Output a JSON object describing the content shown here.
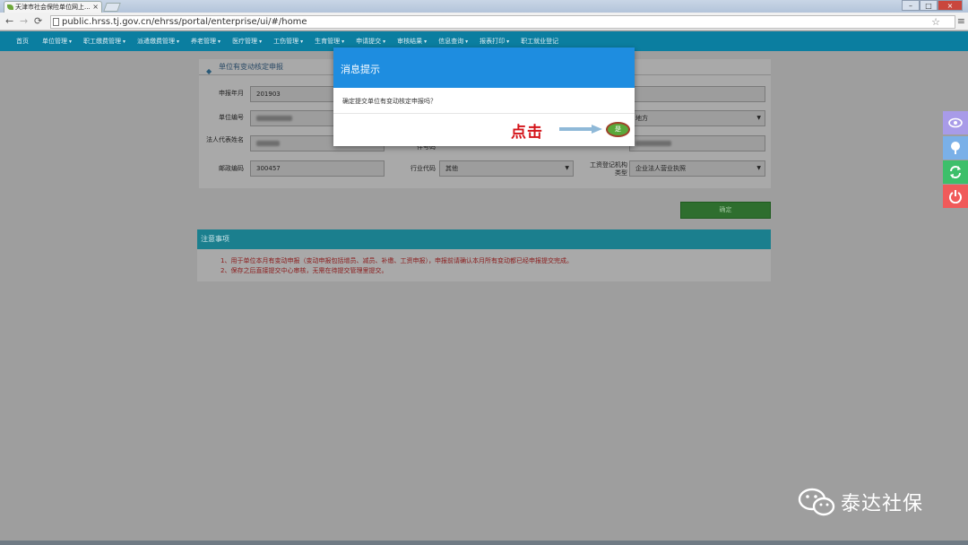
{
  "browser": {
    "tab_title": "天津市社会保险单位网上...",
    "tab_close": "×",
    "url": "public.hrss.tj.gov.cn/ehrss/portal/enterprise/ui/#/home",
    "window_buttons": [
      "–",
      "□",
      "×"
    ]
  },
  "nav": {
    "items": [
      {
        "label": "首页",
        "caret": ""
      },
      {
        "label": "单位管理",
        "caret": "▾"
      },
      {
        "label": "职工缴费管理",
        "caret": "▾"
      },
      {
        "label": "派遣缴费管理",
        "caret": "▾"
      },
      {
        "label": "养老管理",
        "caret": "▾"
      },
      {
        "label": "医疗管理",
        "caret": "▾"
      },
      {
        "label": "工伤管理",
        "caret": "▾"
      },
      {
        "label": "生育管理",
        "caret": "▾"
      },
      {
        "label": "申请提交",
        "caret": "▾"
      },
      {
        "label": "审核结果",
        "caret": "▾"
      },
      {
        "label": "信息查询",
        "caret": "▾"
      },
      {
        "label": "报表打印",
        "caret": "▾"
      },
      {
        "label": "职工就业登记",
        "caret": ""
      }
    ]
  },
  "form": {
    "title": "单位有变动核定申报",
    "fields": {
      "apply_month_label": "申报年月",
      "apply_month_value": "201903",
      "unit_no_label": "单位编号",
      "legal_rep_label": "法人代表姓名",
      "postal_label": "邮政编码",
      "postal_value": "300457",
      "industry_label": "行业代码",
      "industry_value": "其他",
      "id_label_tail": "件号码",
      "region_value": "地方",
      "business_label": "工资登记机构类型",
      "business_value": "企业法人营业执照",
      "confirm_label": "确定"
    }
  },
  "notice": {
    "title": "注意事项",
    "lines": [
      "1、用于单位本月有变动申报（变动申报包括增员、减员、补缴、工资申报），申报前请确认本月所有变动都已经申报提交完成。",
      "2、保存之后直接提交中心审核，无需在待提交管理里提交。"
    ]
  },
  "dialog": {
    "title": "消息提示",
    "message": "确定提交单位有变动核定申报吗？",
    "annotation": "点击",
    "yes_label": "是"
  },
  "side_tools": [
    {
      "icon": "eye-icon",
      "color": "#a89be8"
    },
    {
      "icon": "tree-icon",
      "color": "#7ab0e8"
    },
    {
      "icon": "refresh-icon",
      "color": "#3dbf6a"
    },
    {
      "icon": "power-icon",
      "color": "#f05a5a"
    }
  ],
  "watermark": {
    "text": "泰达社保"
  }
}
